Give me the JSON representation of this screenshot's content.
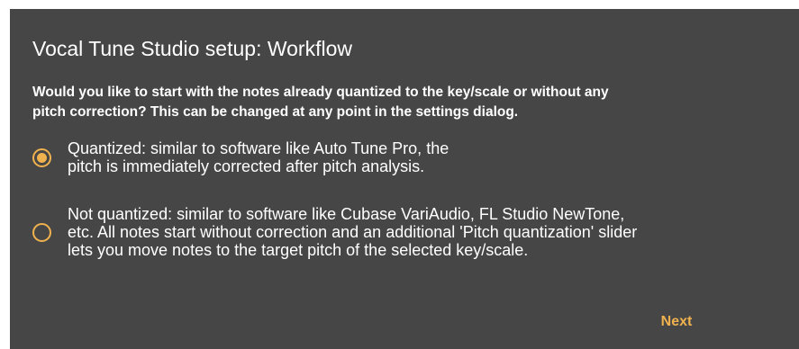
{
  "dialog": {
    "title": "Vocal Tune Studio setup: Workflow",
    "question_line1": "Would you like to start with the notes already quantized to the key/scale or without any",
    "question_line2": "pitch correction? This can be changed at any point in the settings dialog.",
    "options": [
      {
        "selected": true,
        "lines": [
          "Quantized: similar to software like Auto Tune Pro, the",
          "pitch is immediately corrected after pitch analysis."
        ]
      },
      {
        "selected": false,
        "lines": [
          "Not quantized: similar to software like Cubase VariAudio, FL Studio NewTone,",
          "etc. All notes start without correction and an additional 'Pitch quantization' slider",
          "lets you move notes to the target pitch of the selected key/scale."
        ]
      }
    ],
    "next_label": "Next"
  },
  "colors": {
    "background": "#464646",
    "accent": "#f0b24e",
    "text": "#ffffff"
  }
}
